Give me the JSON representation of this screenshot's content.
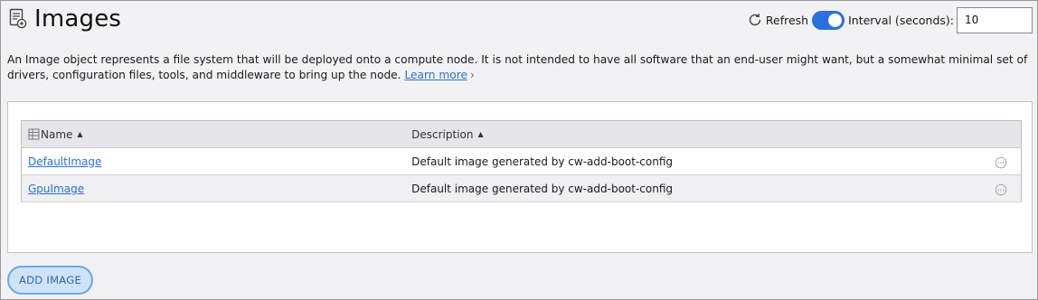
{
  "header": {
    "title": "Images",
    "icon": "document-gear-icon"
  },
  "controls": {
    "refresh_label": "Refresh",
    "refresh_icon": "refresh-icon",
    "auto_refresh_enabled": true,
    "interval_label": "Interval (seconds):",
    "interval_value": "10"
  },
  "description": {
    "text": "An Image object represents a file system that will be deployed onto a compute node. It is not intended to have all software that an end-user might want, but a somewhat minimal set of drivers, configuration files, tools, and middleware to bring up the node.",
    "learn_more": "Learn more"
  },
  "table": {
    "columns": [
      {
        "label": "Name",
        "sort": "▲",
        "icon": "column-picker-icon"
      },
      {
        "label": "Description",
        "sort": "▲"
      }
    ],
    "rows": [
      {
        "name": "DefaultImage",
        "description": "Default image generated by cw-add-boot-config"
      },
      {
        "name": "GpuImage",
        "description": "Default image generated by cw-add-boot-config"
      }
    ]
  },
  "actions": {
    "add_label": "ADD IMAGE"
  },
  "colors": {
    "accent": "#2a6fdb",
    "button_bg": "#cfe3f8",
    "button_border": "#6aa7e8"
  }
}
